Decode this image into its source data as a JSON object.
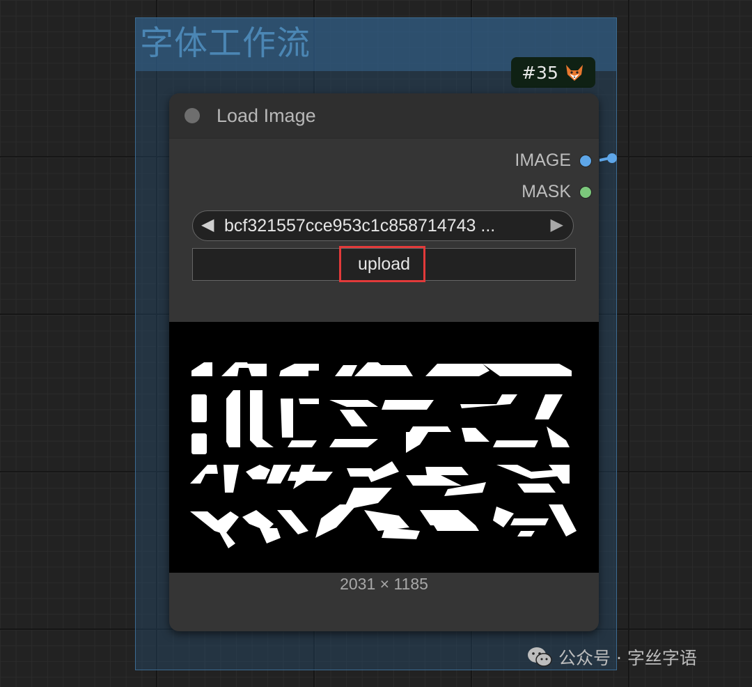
{
  "group": {
    "title": "字体工作流"
  },
  "node_badge": {
    "id": "#35",
    "icon": "fox-icon"
  },
  "node": {
    "title": "Load Image",
    "outputs": [
      {
        "label": "IMAGE",
        "color": "#5ea6e8"
      },
      {
        "label": "MASK",
        "color": "#7cc87c"
      }
    ],
    "image_combo": {
      "value": "bcf321557cce953c1c858714743  ...",
      "prev_arrow": "◀",
      "next_arrow": "▶"
    },
    "upload_label": "upload",
    "image_dimensions": "2031 × 1185"
  },
  "watermark": {
    "text": "公众号 · 字丝字语",
    "icon": "wechat-icon"
  },
  "colors": {
    "highlight": "#e23a3a",
    "group_title": "#4b86b4",
    "link": "#5ea6e8"
  }
}
